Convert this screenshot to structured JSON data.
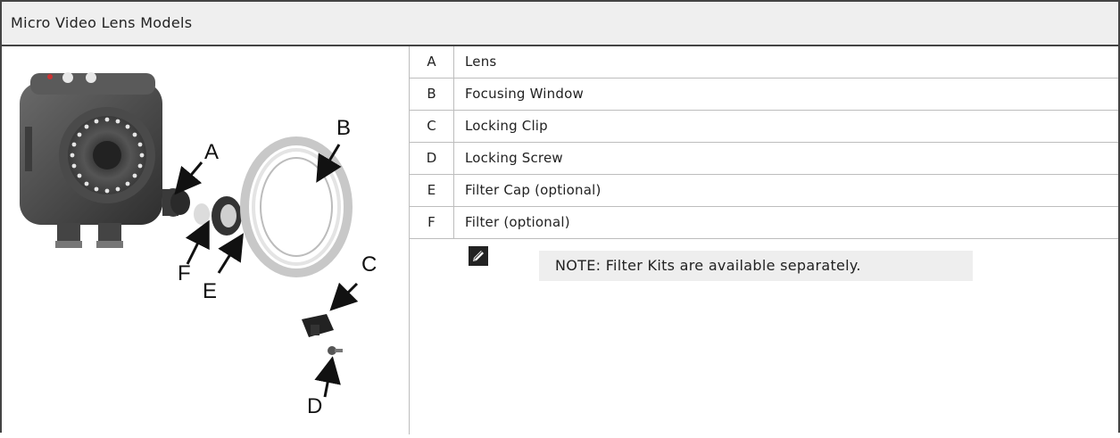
{
  "title": "Micro Video Lens Models",
  "parts": [
    {
      "key": "A",
      "label": "Lens"
    },
    {
      "key": "B",
      "label": "Focusing Window"
    },
    {
      "key": "C",
      "label": "Locking Clip"
    },
    {
      "key": "D",
      "label": "Locking Screw"
    },
    {
      "key": "E",
      "label": "Filter Cap (optional)"
    },
    {
      "key": "F",
      "label": "Filter (optional)"
    }
  ],
  "note": {
    "icon": "pencil-note-icon",
    "text": "NOTE: Filter Kits are available separately."
  },
  "diagram": {
    "callouts": [
      "A",
      "B",
      "C",
      "D",
      "E",
      "F"
    ]
  }
}
